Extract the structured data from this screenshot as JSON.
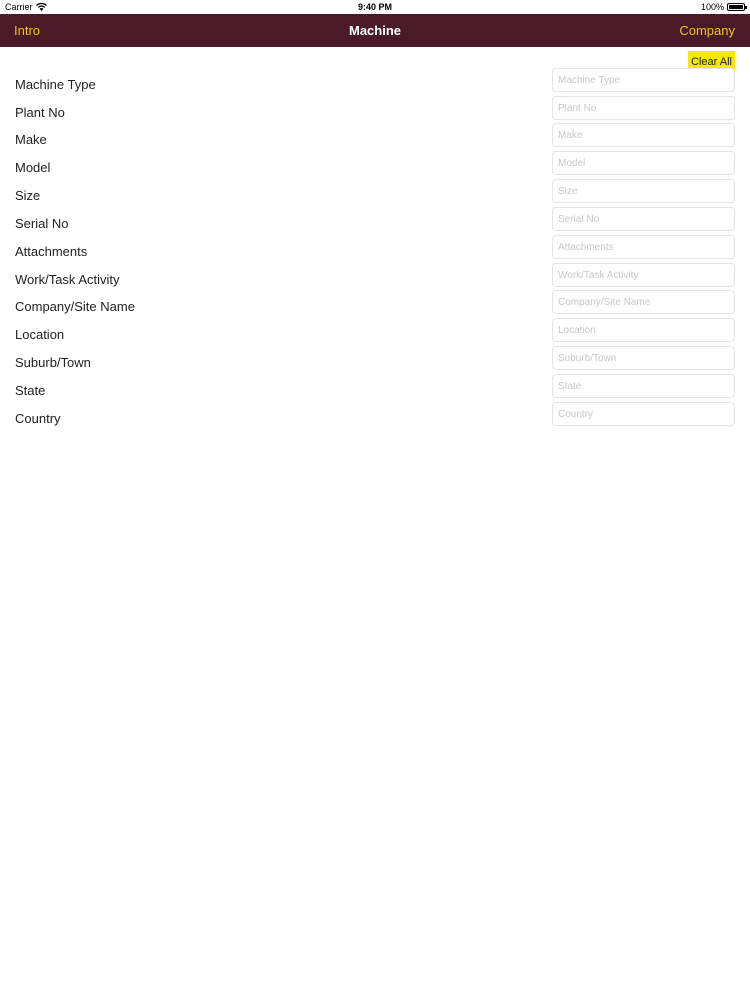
{
  "status_bar": {
    "carrier": "Carrier",
    "wifi_icon": "wifi-icon",
    "time": "9:40 PM",
    "battery": "100%",
    "battery_icon": "battery-icon"
  },
  "nav": {
    "left_label": "Intro",
    "title": "Machine",
    "right_label": "Company",
    "background_color": "#4a1a26",
    "accent_color": "#e8c51c"
  },
  "toolbar": {
    "clear_all_label": "Clear All",
    "clear_all_color": "#f5e60e"
  },
  "form": {
    "fields": [
      {
        "label": "Machine Type",
        "placeholder": "Machine Type",
        "value": ""
      },
      {
        "label": "Plant No",
        "placeholder": "Plant No",
        "value": ""
      },
      {
        "label": "Make",
        "placeholder": "Make",
        "value": ""
      },
      {
        "label": "Model",
        "placeholder": "Model",
        "value": ""
      },
      {
        "label": "Size",
        "placeholder": "Size",
        "value": ""
      },
      {
        "label": "Serial No",
        "placeholder": "Serial No",
        "value": ""
      },
      {
        "label": "Attachments",
        "placeholder": "Attachments",
        "value": ""
      },
      {
        "label": "Work/Task Activity",
        "placeholder": "Work/Task Activity",
        "value": ""
      },
      {
        "label": "Company/Site Name",
        "placeholder": "Company/Site Name",
        "value": ""
      },
      {
        "label": "Location",
        "placeholder": "Location",
        "value": ""
      },
      {
        "label": "Suburb/Town",
        "placeholder": "Suburb/Town",
        "value": ""
      },
      {
        "label": "State",
        "placeholder": "State",
        "value": ""
      },
      {
        "label": "Country",
        "placeholder": "Country",
        "value": ""
      }
    ]
  }
}
